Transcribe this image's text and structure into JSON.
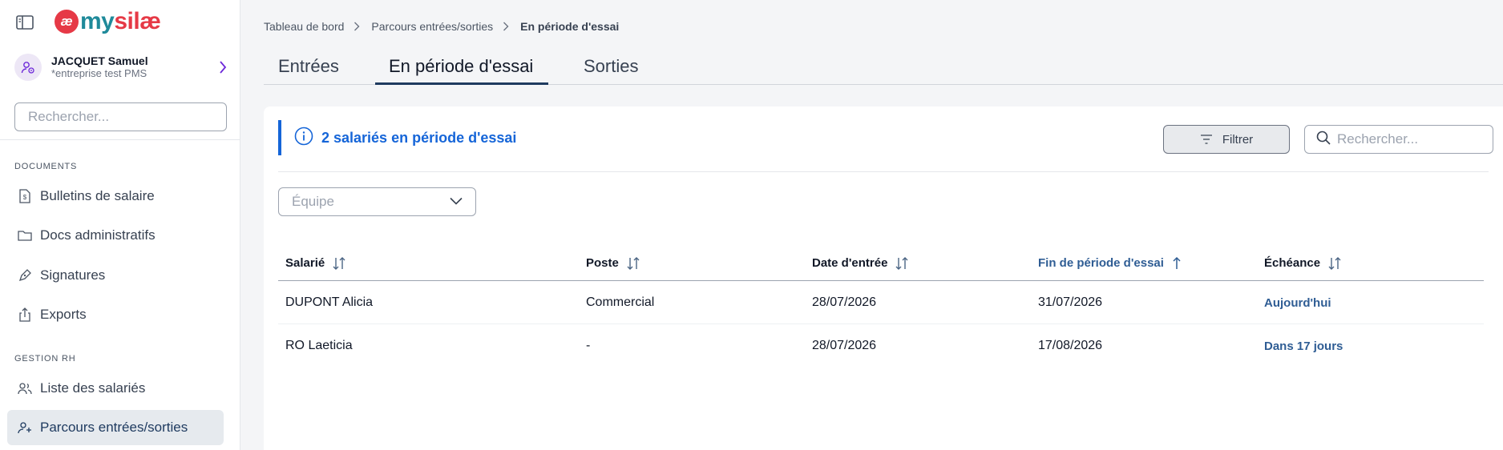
{
  "logo": {
    "mark": "æ",
    "word_my": "my",
    "word_silae": "silæ"
  },
  "user": {
    "name": "JACQUET Samuel",
    "company": "*entreprise test PMS"
  },
  "sidebar": {
    "search_placeholder": "Rechercher...",
    "sections": [
      {
        "title": "DOCUMENTS",
        "items": [
          "Bulletins de salaire",
          "Docs administratifs",
          "Signatures",
          "Exports"
        ]
      },
      {
        "title": "GESTION RH",
        "items": [
          "Liste des salariés",
          "Parcours entrées/sorties"
        ]
      }
    ],
    "active_item": "Parcours entrées/sorties"
  },
  "breadcrumb": [
    "Tableau de bord",
    "Parcours entrées/sorties",
    "En période d'essai"
  ],
  "tabs": [
    {
      "label": "Entrées",
      "active": false
    },
    {
      "label": "En période d'essai",
      "active": true
    },
    {
      "label": "Sorties",
      "active": false
    }
  ],
  "info": {
    "text": "2 salariés en période d'essai"
  },
  "filter_button": {
    "label": "Filtrer"
  },
  "search": {
    "placeholder": "Rechercher..."
  },
  "team_select": {
    "placeholder": "Équipe"
  },
  "table": {
    "columns": [
      {
        "label": "Salarié",
        "sort": "both"
      },
      {
        "label": "Poste",
        "sort": "both"
      },
      {
        "label": "Date d'entrée",
        "sort": "both"
      },
      {
        "label": "Fin de période d'essai",
        "sort": "asc"
      },
      {
        "label": "Échéance",
        "sort": "both"
      }
    ],
    "rows": [
      [
        "DUPONT Alicia",
        "Commercial",
        "28/07/2026",
        "31/07/2026",
        "Aujourd'hui"
      ],
      [
        "RO Laeticia",
        "-",
        "28/07/2026",
        "17/08/2026",
        "Dans 17 jours"
      ]
    ]
  },
  "colors": {
    "accent": "#1e3a5f",
    "info_blue": "#1565d8",
    "sorted_header": "#2f5d94",
    "logo_red": "#e63946",
    "logo_teal": "#1f8a9a"
  }
}
